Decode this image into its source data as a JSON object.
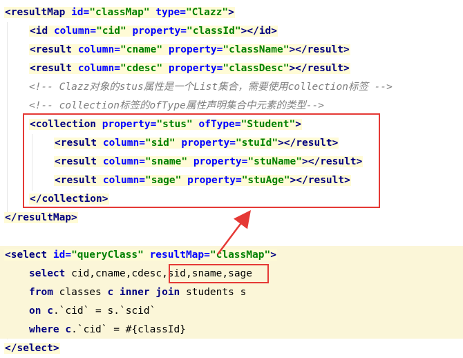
{
  "code_lines": [
    "<resultMap id=\"classMap\" type=\"Clazz\">",
    "<id column=\"cid\" property=\"classId\"></id>",
    "<result column=\"cname\" property=\"className\"></result>",
    "<result column=\"cdesc\" property=\"classDesc\"></result>",
    "<!-- Clazz对象的stus属性是一个List集合，需要使用collection标签 -->",
    "<!-- collection标签的ofType属性声明集合中元素的类型-->",
    "<collection property=\"stus\" ofType=\"Student\">",
    "<result column=\"sid\" property=\"stuId\"></result>",
    "<result column=\"sname\" property=\"stuName\"></result>",
    "<result column=\"sage\" property=\"stuAge\"></result>",
    "</collection>",
    "</resultMap>",
    "<select id=\"queryClass\" resultMap=\"classMap\">",
    "select cid,cname,cdesc,sid,sname,sage",
    "from classes c inner join students s",
    "on c.`cid` = s.`scid`",
    "where c.`cid` = #{classId}",
    "</select>"
  ],
  "colors": {
    "tag": "#000080",
    "attribute": "#0000ff",
    "value": "#008000",
    "comment": "#808080",
    "highlight_box": "#e53935",
    "sql_background": "#fbf6d8"
  }
}
